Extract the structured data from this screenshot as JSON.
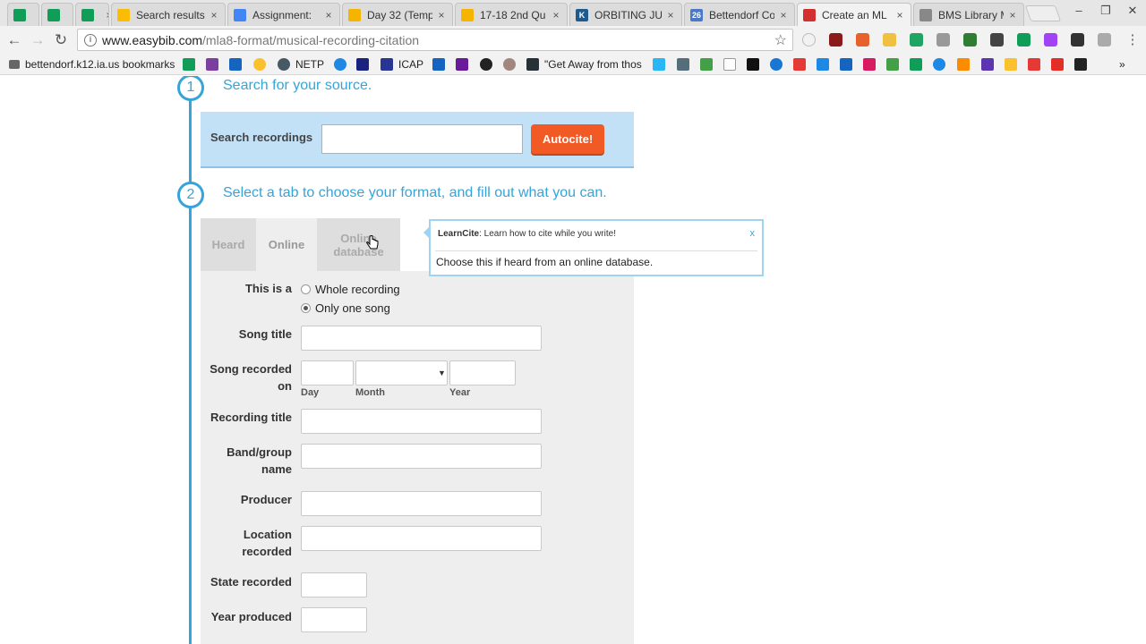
{
  "browser": {
    "tabs": [
      {
        "title": "",
        "favicon_color": "#0f9d58",
        "active": false
      },
      {
        "title": "",
        "favicon_color": "#0f9d58",
        "active": false
      },
      {
        "title": "",
        "favicon_color": "#0f9d58",
        "active": false
      },
      {
        "title": "Search results",
        "favicon_color": "#fbbc05",
        "active": false
      },
      {
        "title": "Assignment:",
        "favicon_color": "#4285f4",
        "active": false
      },
      {
        "title": "Day 32 (Temp",
        "favicon_color": "#f4b400",
        "active": false
      },
      {
        "title": "17-18 2nd Qu",
        "favicon_color": "#f4b400",
        "active": false
      },
      {
        "title": "ORBITING JUP",
        "favicon_color": "#1d5a8e",
        "active": false
      },
      {
        "title": "Bettendorf Co",
        "favicon_color": "#4a78c9",
        "active": false
      },
      {
        "title": "Create an ML",
        "favicon_color": "#d32f2f",
        "active": true
      },
      {
        "title": "BMS Library M",
        "favicon_color": "#888888",
        "active": false
      }
    ],
    "tab_close_glyph": "×",
    "window_controls": [
      "–",
      "❐",
      "✕"
    ],
    "address": {
      "host": "www.easybib.com",
      "path": "/mla8-format/musical-recording-citation"
    },
    "bookmarks": [
      {
        "label": "bettendorf.k12.ia.us bookmarks"
      },
      {
        "label": "NETP"
      },
      {
        "label": "ICAP"
      },
      {
        "label": "\"Get Away from thos"
      }
    ],
    "bookmarks_more": "»"
  },
  "page": {
    "step1": {
      "number": "1",
      "text": "Search for your source."
    },
    "search": {
      "label": "Search recordings",
      "value": "",
      "button": "Autocite!"
    },
    "step2": {
      "number": "2",
      "text": "Select a tab to choose your format, and fill out what you can."
    },
    "format_tabs": [
      {
        "label": "Heard"
      },
      {
        "label": "Online"
      },
      {
        "label": "Online database"
      }
    ],
    "form": {
      "this_is_a": "This is a",
      "radio_whole": "Whole recording",
      "radio_song": "Only one song",
      "selected_radio": "song",
      "song_title": "Song title",
      "song_recorded_on": "Song recorded on",
      "day": "Day",
      "month": "Month",
      "year": "Year",
      "recording_title": "Recording title",
      "band_group_name": "Band/group name",
      "producer": "Producer",
      "location_recorded": "Location recorded",
      "state_recorded": "State recorded",
      "year_produced": "Year produced"
    },
    "tooltip": {
      "brand": "LearnCite",
      "tagline": ": Learn how to cite while you write!",
      "close": "x",
      "body": "Choose this if heard from an online database."
    }
  },
  "colors": {
    "accent": "#35a4d8",
    "button": "#f15a24",
    "search_panel": "#c2e1f7"
  }
}
